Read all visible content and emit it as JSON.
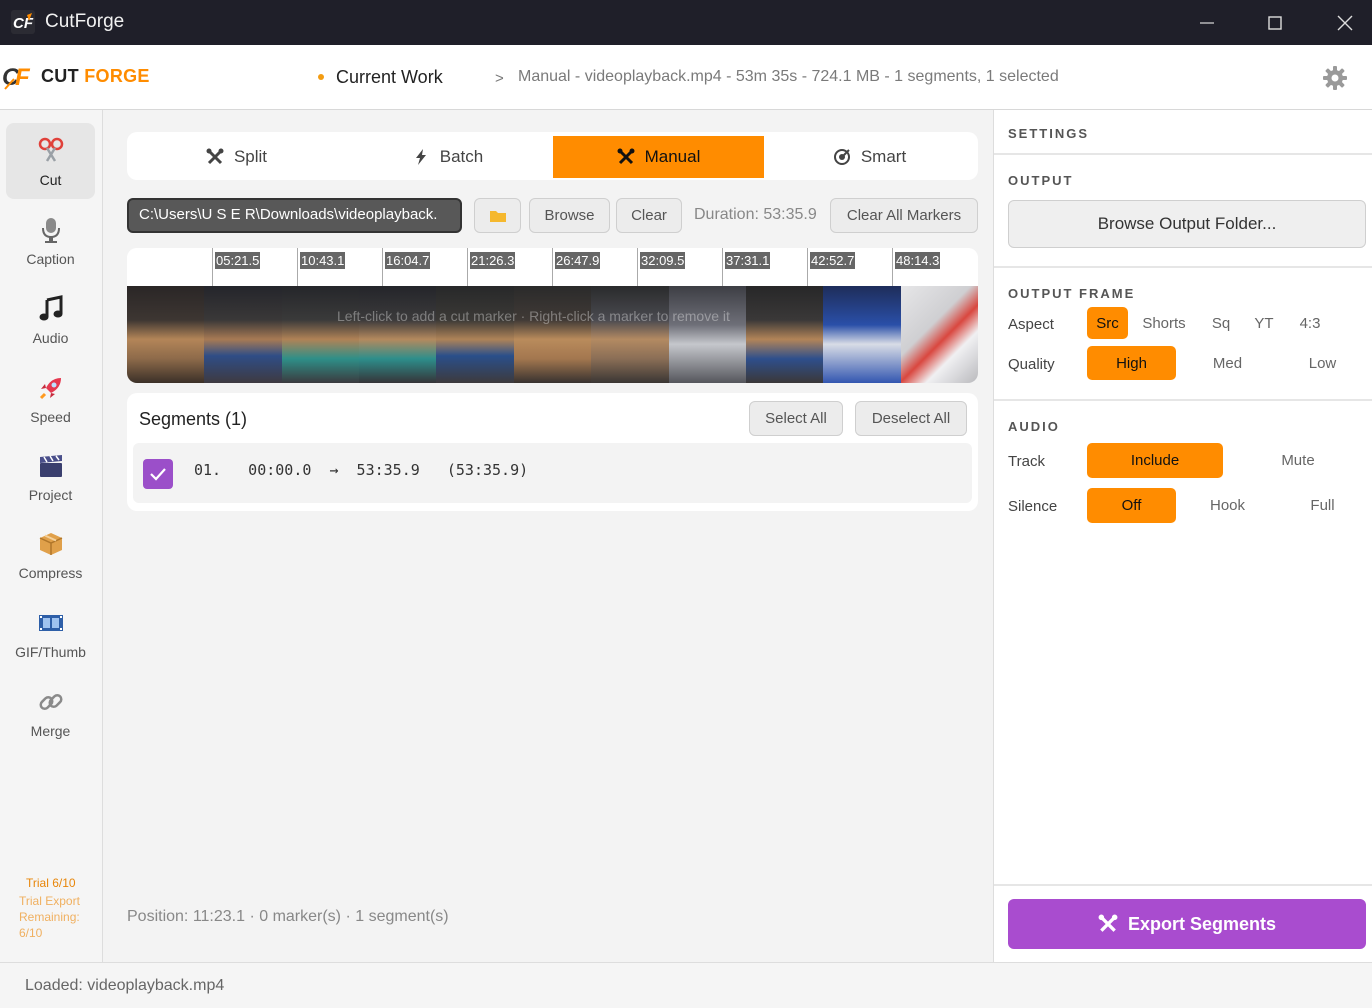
{
  "window": {
    "title": "CutForge"
  },
  "header": {
    "brand_word1": "CUT",
    "brand_word2": "FORGE",
    "current": "Current Work",
    "separator": ">",
    "info": "Manual - videoplayback.mp4 - 53m 35s - 724.1 MB - 1 segments, 1 selected"
  },
  "sidebar": {
    "items": [
      {
        "label": "Cut",
        "icon": "scissors-icon"
      },
      {
        "label": "Caption",
        "icon": "microphone-icon"
      },
      {
        "label": "Audio",
        "icon": "music-note-icon"
      },
      {
        "label": "Speed",
        "icon": "rocket-icon"
      },
      {
        "label": "Project",
        "icon": "clapperboard-icon"
      },
      {
        "label": "Compress",
        "icon": "package-icon"
      },
      {
        "label": "GIF/Thumb",
        "icon": "film-strip-icon"
      },
      {
        "label": "Merge",
        "icon": "link-icon"
      }
    ],
    "trial_title": "Trial 6/10",
    "trial_sub": "Trial Export Remaining: 6/10"
  },
  "tabs": [
    "Split",
    "Batch",
    "Manual",
    "Smart"
  ],
  "file": {
    "path": "C:\\Users\\U S E R\\Downloads\\videoplayback.",
    "browse": "Browse",
    "clear": "Clear",
    "duration": "Duration: 53:35.9",
    "clear_markers": "Clear All Markers"
  },
  "timeline": {
    "ticks": [
      "05:21.5",
      "10:43.1",
      "16:04.7",
      "21:26.3",
      "26:47.9",
      "32:09.5",
      "37:31.1",
      "42:52.7",
      "48:14.3"
    ],
    "hint": "Left-click to add a cut marker · Right-click a marker to remove it"
  },
  "segments": {
    "title": "Segments (1)",
    "select_all": "Select All",
    "deselect_all": "Deselect All",
    "rows": [
      {
        "text": "01.   00:00.0  →  53:35.9   (53:35.9)",
        "checked": true
      }
    ]
  },
  "status": "Position: 11:23.1  ·  0 marker(s)  ·  1 segment(s)",
  "settings": {
    "heading": "SETTINGS",
    "output_heading": "OUTPUT",
    "browse_output": "Browse Output Folder...",
    "frame_heading": "OUTPUT FRAME",
    "aspect_label": "Aspect",
    "aspect_options": [
      "Src",
      "Shorts",
      "Sq",
      "YT",
      "4:3"
    ],
    "quality_label": "Quality",
    "quality_options": [
      "High",
      "Med",
      "Low"
    ],
    "audio_heading": "AUDIO",
    "track_label": "Track",
    "track_options": [
      "Include",
      "Mute"
    ],
    "silence_label": "Silence",
    "silence_options": [
      "Off",
      "Hook",
      "Full"
    ],
    "export": "Export Segments"
  },
  "footer": "Loaded: videoplayback.mp4",
  "colors": {
    "accent": "#ff8c00",
    "export": "#a94ccf",
    "check": "#9b4fc9"
  }
}
